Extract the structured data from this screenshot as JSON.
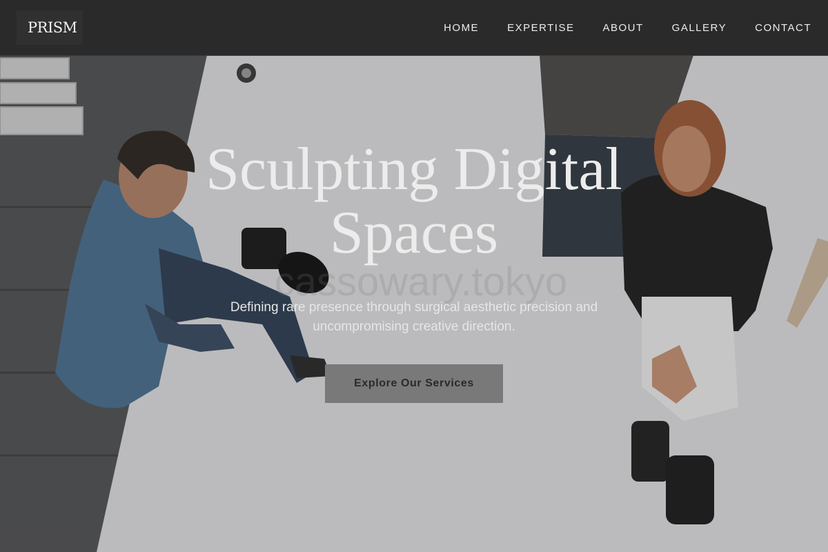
{
  "header": {
    "logo": "PRISM",
    "nav": [
      {
        "label": "HOME"
      },
      {
        "label": "EXPERTISE"
      },
      {
        "label": "ABOUT"
      },
      {
        "label": "GALLERY"
      },
      {
        "label": "CONTACT"
      }
    ]
  },
  "hero": {
    "title": "Sculpting Digital Spaces",
    "watermark": "cassowary.tokyo",
    "subtitle": "Defining rare presence through surgical aesthetic precision and uncompromising creative direction.",
    "cta_label": "Explore Our Services",
    "image": {
      "description_icon": "hero-photo-icon"
    }
  },
  "colors": {
    "header_bg": "#2a2a2a",
    "cta_bg": "#797979",
    "text_light": "#ececec",
    "floor_light": "#dcdcde",
    "floor_dark": "#4a4b4d"
  }
}
